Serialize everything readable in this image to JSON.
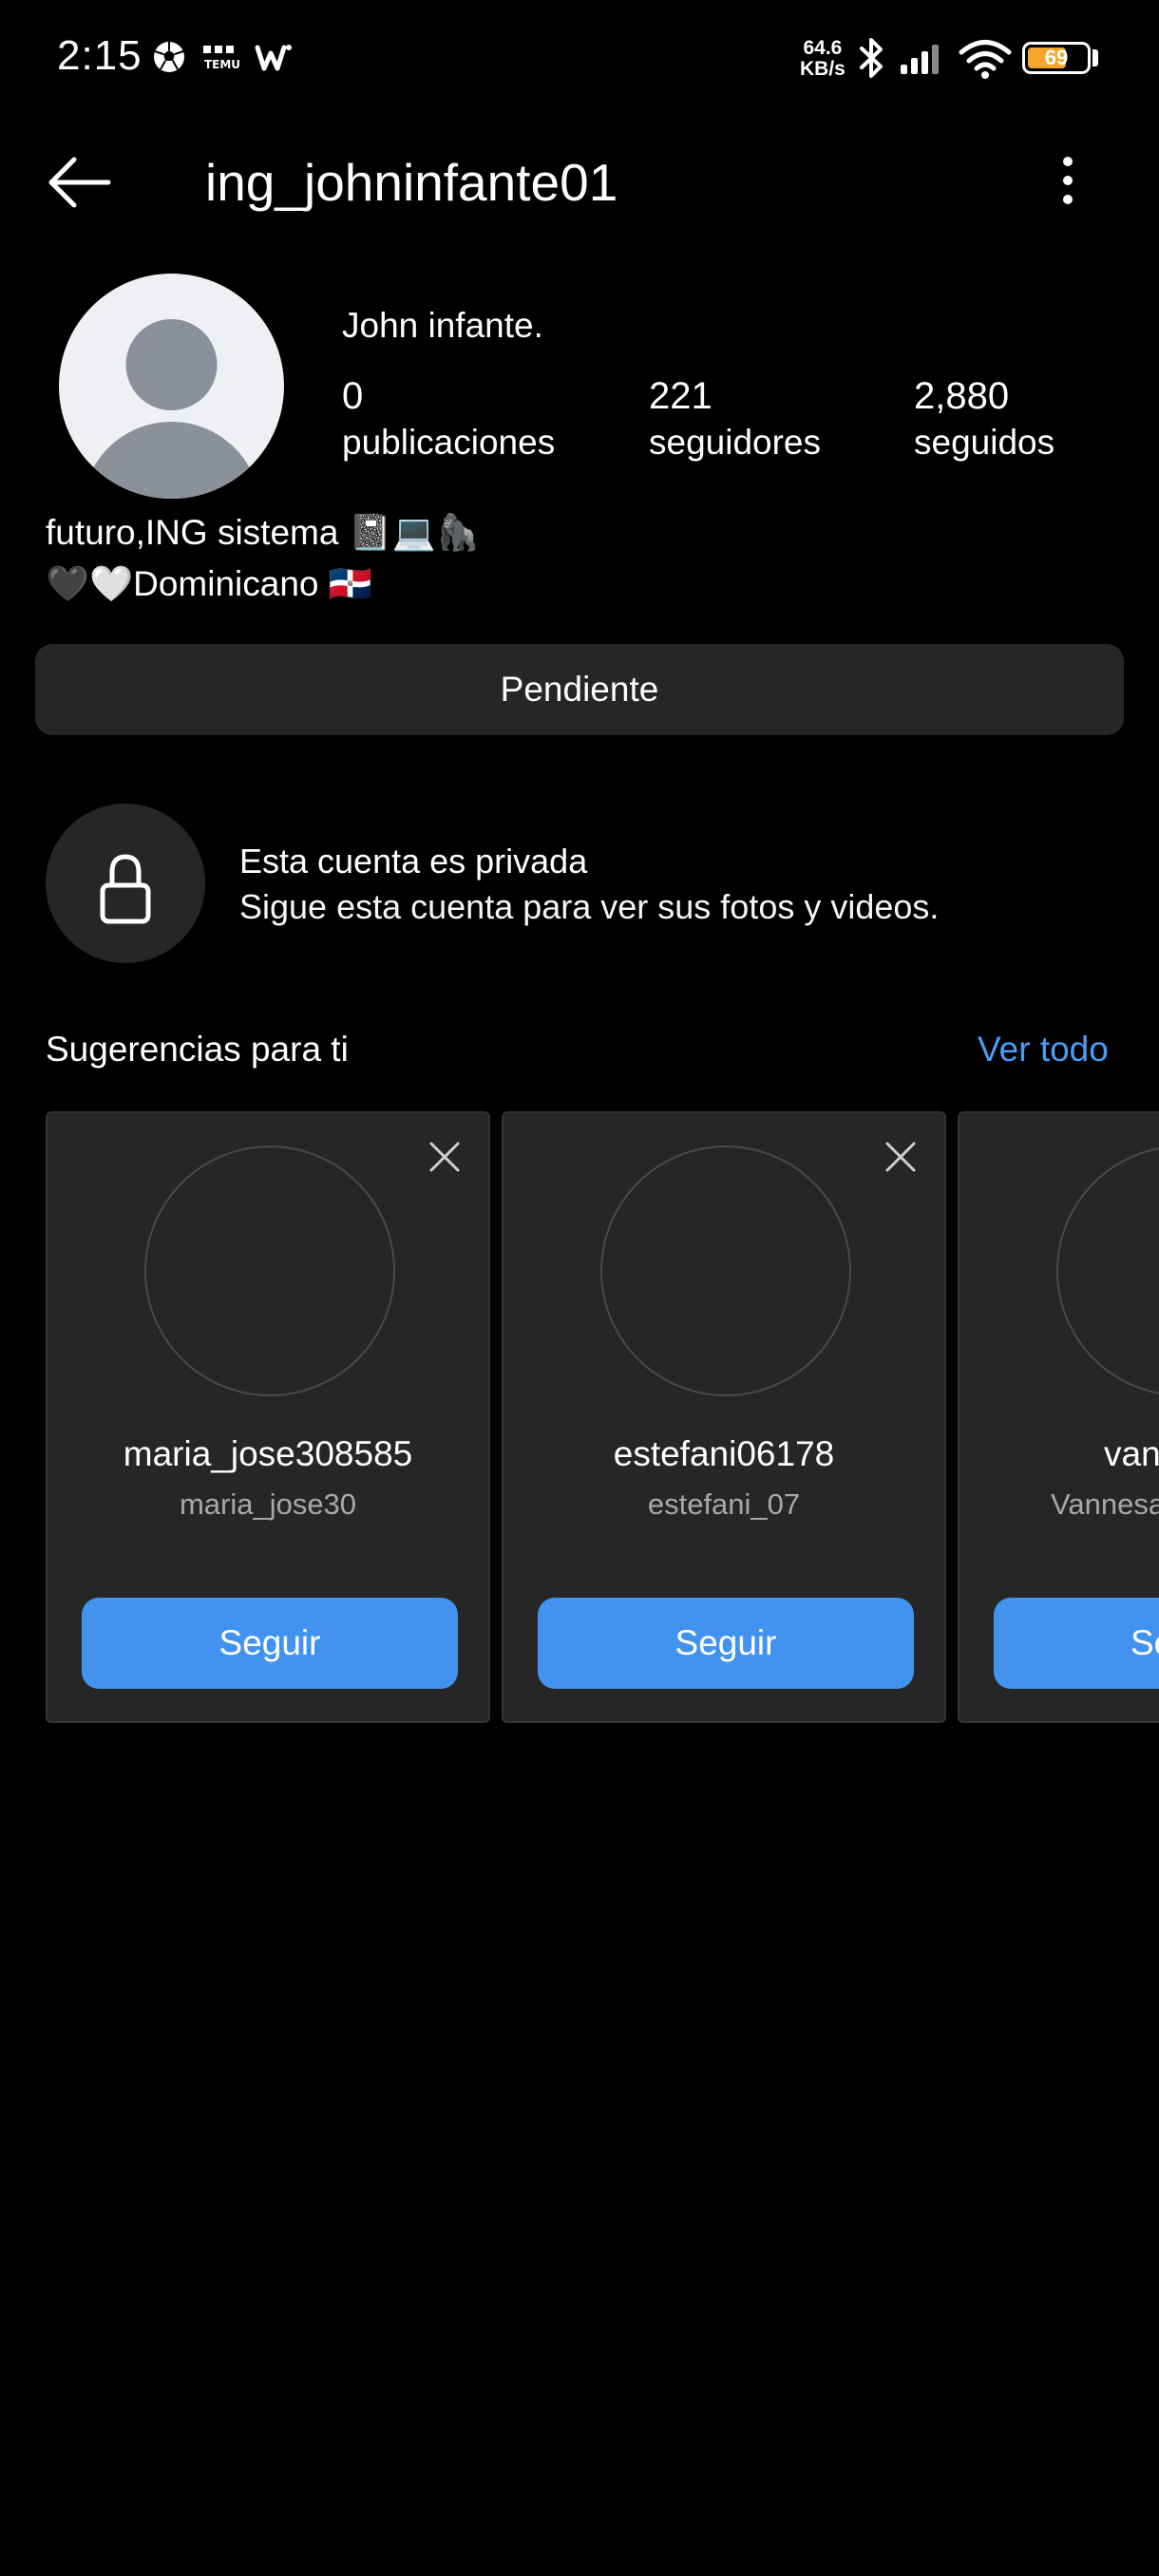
{
  "status_bar": {
    "time": "2:15",
    "net_speed_value": "64.6",
    "net_speed_unit": "KB/s",
    "battery": "69",
    "battery_level": 0.69,
    "icons": [
      "soccer-ball-icon",
      "temu-icon",
      "wattpad-icon",
      "bluetooth-icon",
      "signal-icon",
      "wifi-icon",
      "battery-icon"
    ]
  },
  "header": {
    "username": "ing_johninfante01"
  },
  "profile": {
    "display_name": "John infante.",
    "stats": [
      {
        "value": "0",
        "label": "publicaciones"
      },
      {
        "value": "221",
        "label": "seguidores"
      },
      {
        "value": "2,880",
        "label": "seguidos"
      }
    ],
    "bio_line1": "futuro,ING sistema 📓💻🦍",
    "bio_line2": "🖤🤍Dominicano 🇩🇴",
    "pending_button": "Pendiente"
  },
  "private_notice": {
    "title": "Esta cuenta es privada",
    "subtitle": "Sigue esta cuenta para ver sus fotos y videos."
  },
  "suggestions": {
    "title": "Sugerencias para ti",
    "see_all": "Ver todo",
    "cards": [
      {
        "username": "maria_jose308585",
        "name": "maria_jose30",
        "follow": "Seguir"
      },
      {
        "username": "estefani06178",
        "name": "estefani_07",
        "follow": "Seguir"
      },
      {
        "username": "vann",
        "name": "Vannesa",
        "follow": "Se"
      }
    ]
  },
  "colors": {
    "background": "#000000",
    "surface": "#262626",
    "accent": "#4193ef",
    "link": "#4a9cf5",
    "battery": "#f4a62a"
  }
}
